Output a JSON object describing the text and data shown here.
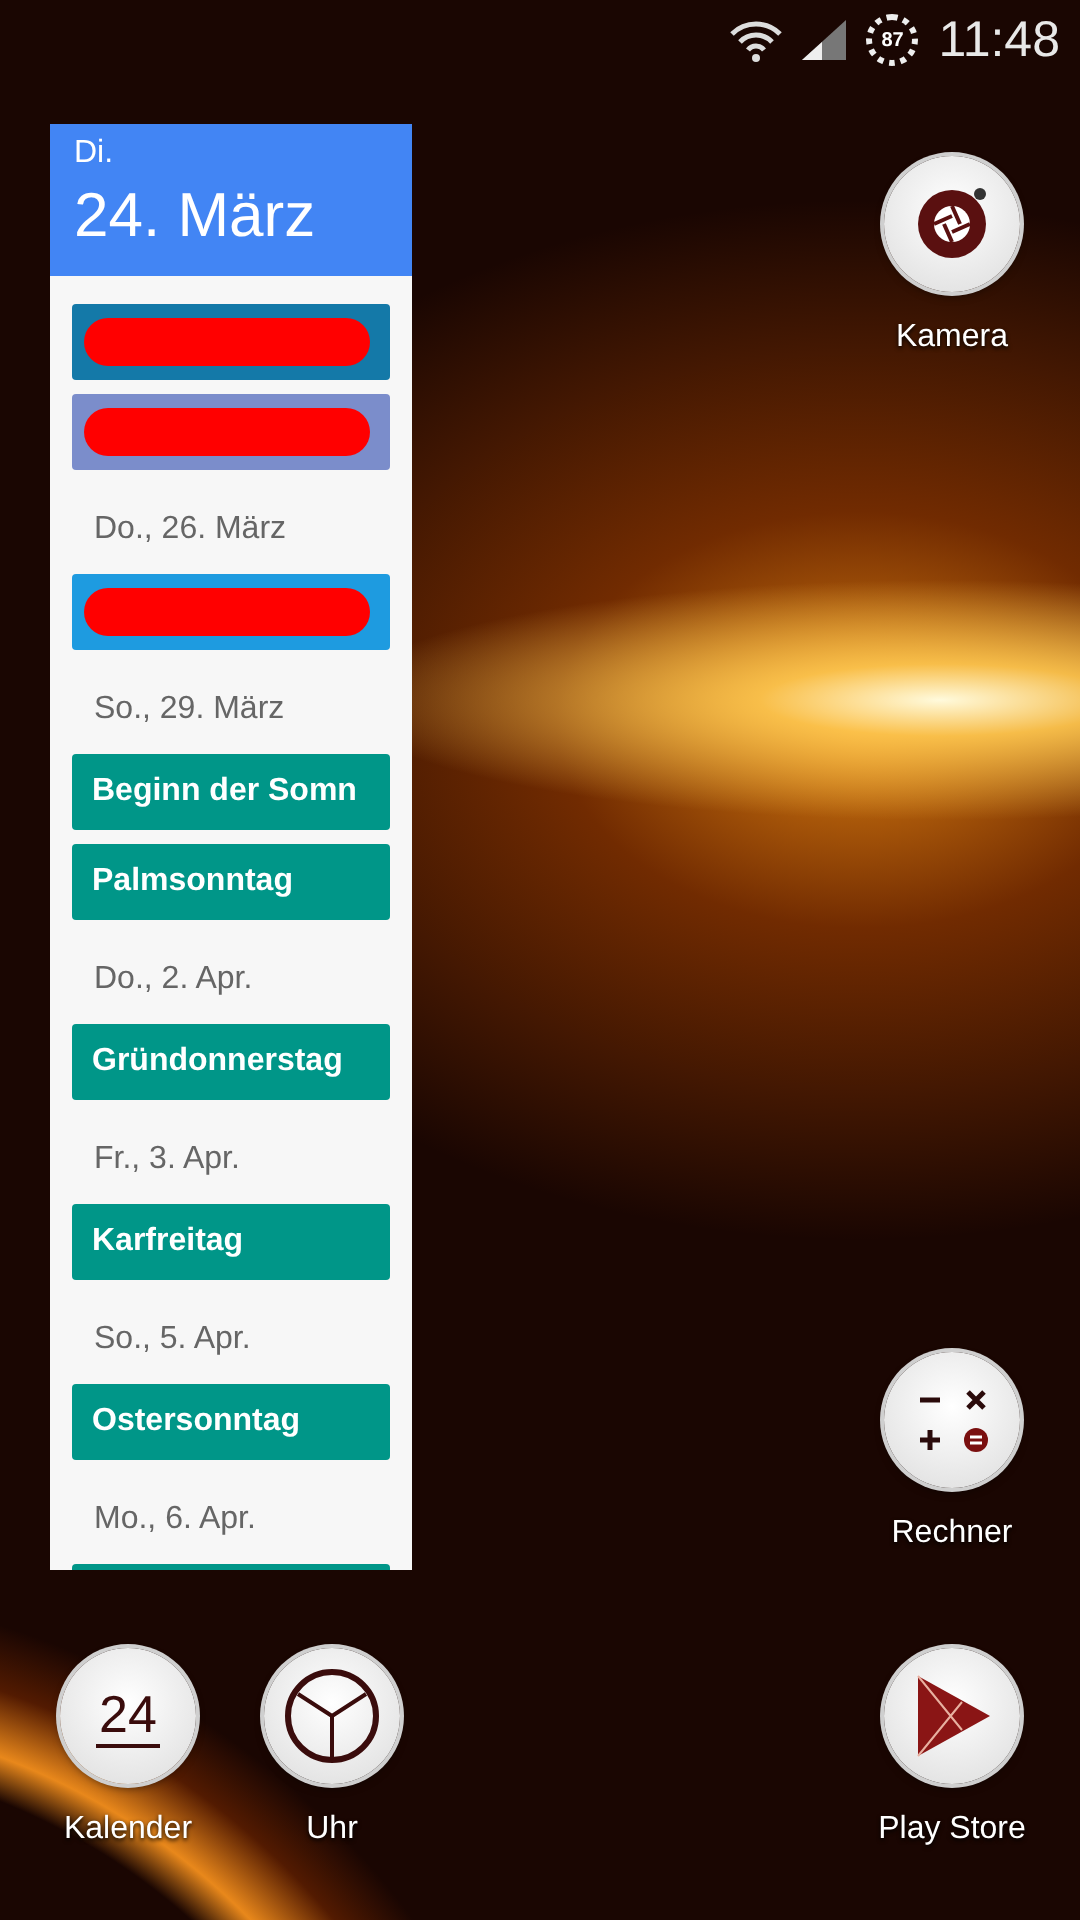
{
  "status_bar": {
    "battery": "87",
    "time": "11:48"
  },
  "calendar_widget": {
    "weekday": "Di.",
    "date": "24. März",
    "items": [
      {
        "kind": "redacted",
        "color": "#1479a8"
      },
      {
        "kind": "redacted",
        "color": "#7b8dcb"
      },
      {
        "kind": "date",
        "label": "Do., 26. März"
      },
      {
        "kind": "redacted",
        "color": "#1e9be0"
      },
      {
        "kind": "date",
        "label": "So., 29. März"
      },
      {
        "kind": "event",
        "label": "Beginn der Somn",
        "color": "#009688"
      },
      {
        "kind": "event",
        "label": "Palmsonntag",
        "color": "#009688"
      },
      {
        "kind": "date",
        "label": "Do., 2. Apr."
      },
      {
        "kind": "event",
        "label": "Gründonnerstag",
        "color": "#009688"
      },
      {
        "kind": "date",
        "label": "Fr., 3. Apr."
      },
      {
        "kind": "event",
        "label": "Karfreitag",
        "color": "#009688"
      },
      {
        "kind": "date",
        "label": "So., 5. Apr."
      },
      {
        "kind": "event",
        "label": "Ostersonntag",
        "color": "#009688"
      },
      {
        "kind": "date",
        "label": "Mo., 6. Apr."
      },
      {
        "kind": "event",
        "color": "#009688"
      }
    ]
  },
  "apps": [
    {
      "kind": "camera",
      "label": "Kamera"
    },
    {
      "kind": "calculator",
      "label": "Rechner"
    },
    {
      "kind": "calendar",
      "label": "Kalender",
      "icon_text": "24"
    },
    {
      "kind": "clock",
      "label": "Uhr"
    },
    {
      "kind": "store",
      "label": "Play Store"
    }
  ]
}
